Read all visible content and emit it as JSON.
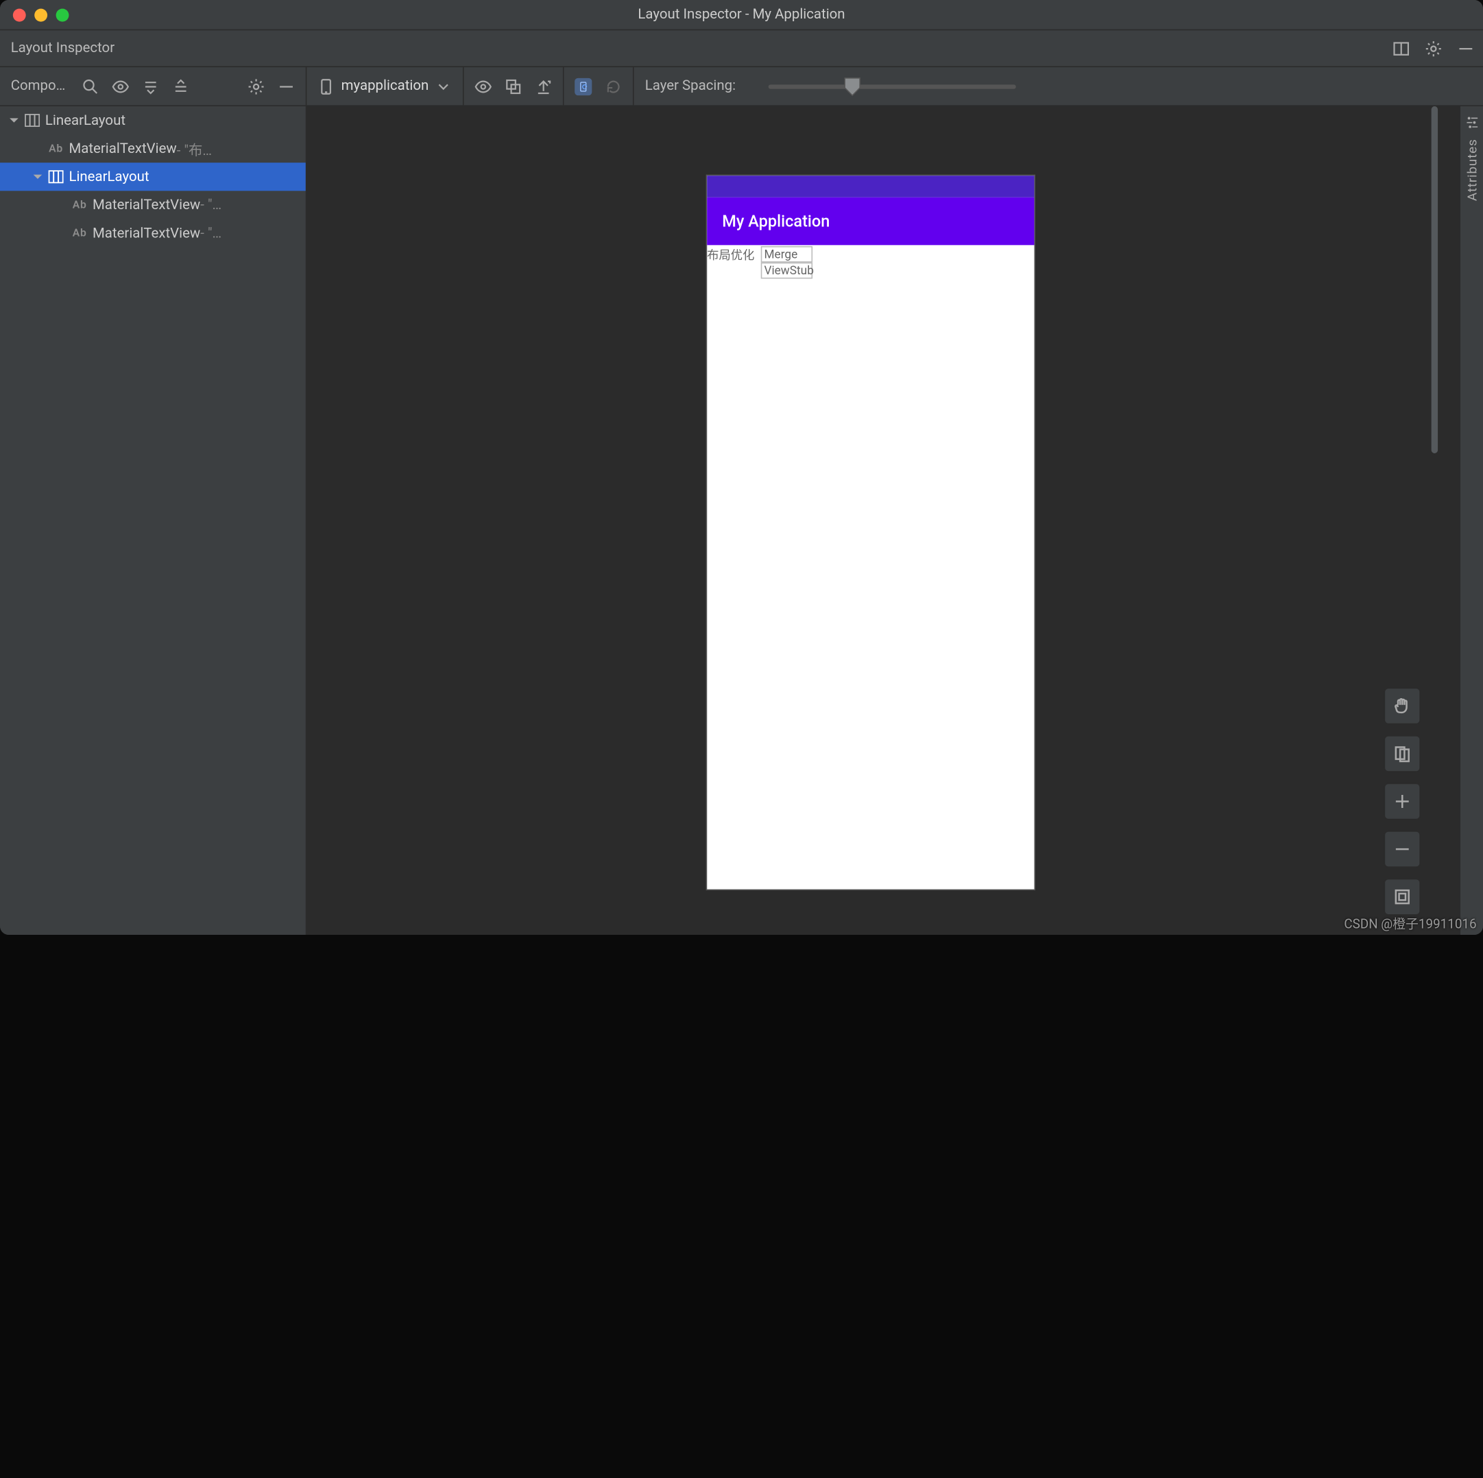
{
  "window": {
    "title": "Layout Inspector - My Application"
  },
  "tool_header": {
    "title": "Layout Inspector"
  },
  "toolbar": {
    "tree_panel_label": "Compo…",
    "device_label": "myapplication",
    "layer_spacing_label": "Layer Spacing:"
  },
  "tree": {
    "nodes": [
      {
        "depth": 0,
        "expander": "down",
        "icon": "layout",
        "name": "LinearLayout",
        "suffix": "",
        "selected": false
      },
      {
        "depth": 1,
        "expander": "none",
        "icon": "ab",
        "name": "MaterialTextView",
        "suffix": " - \"布…",
        "selected": false
      },
      {
        "depth": 1,
        "expander": "down",
        "icon": "layout",
        "name": "LinearLayout",
        "suffix": "",
        "selected": true
      },
      {
        "depth": 2,
        "expander": "none",
        "icon": "ab",
        "name": "MaterialTextView",
        "suffix": " - \"…",
        "selected": false
      },
      {
        "depth": 2,
        "expander": "none",
        "icon": "ab",
        "name": "MaterialTextView",
        "suffix": " - \"…",
        "selected": false
      }
    ]
  },
  "preview": {
    "app_title": "My Application",
    "cell1": "布局优化",
    "cell2": "Merge",
    "cell3": "ViewStub"
  },
  "attributes_tab": {
    "label": "Attributes"
  },
  "watermark": "CSDN @橙子19911016"
}
